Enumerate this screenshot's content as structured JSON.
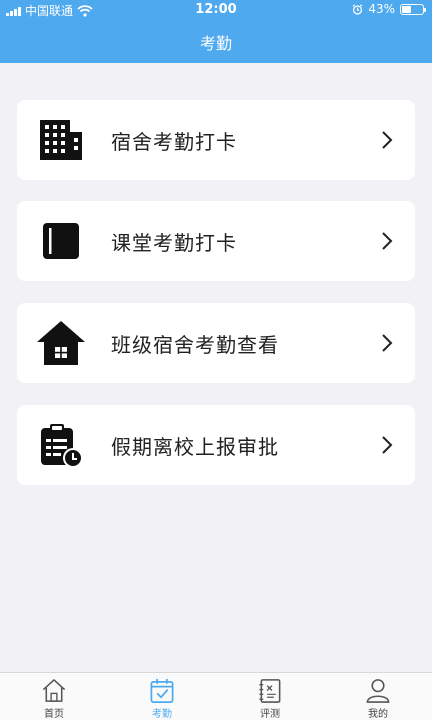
{
  "status_bar": {
    "carrier": "中国联通",
    "time": "12:00",
    "battery": "43%",
    "battery_level": 0.43
  },
  "header": {
    "title": "考勤"
  },
  "menu": [
    {
      "label": "宿舍考勤打卡",
      "icon": "building-icon"
    },
    {
      "label": "课堂考勤打卡",
      "icon": "book-icon"
    },
    {
      "label": "班级宿舍考勤查看",
      "icon": "house-icon"
    },
    {
      "label": "假期离校上报审批",
      "icon": "clipboard-clock-icon"
    }
  ],
  "tabs": [
    {
      "label": "首页",
      "icon": "home-icon",
      "active": false
    },
    {
      "label": "考勤",
      "icon": "calendar-check-icon",
      "active": true
    },
    {
      "label": "评测",
      "icon": "notebook-icon",
      "active": false
    },
    {
      "label": "我的",
      "icon": "user-icon",
      "active": false
    }
  ],
  "colors": {
    "accent": "#4ea9ef",
    "background": "#f1f1f6",
    "card": "#ffffff"
  }
}
